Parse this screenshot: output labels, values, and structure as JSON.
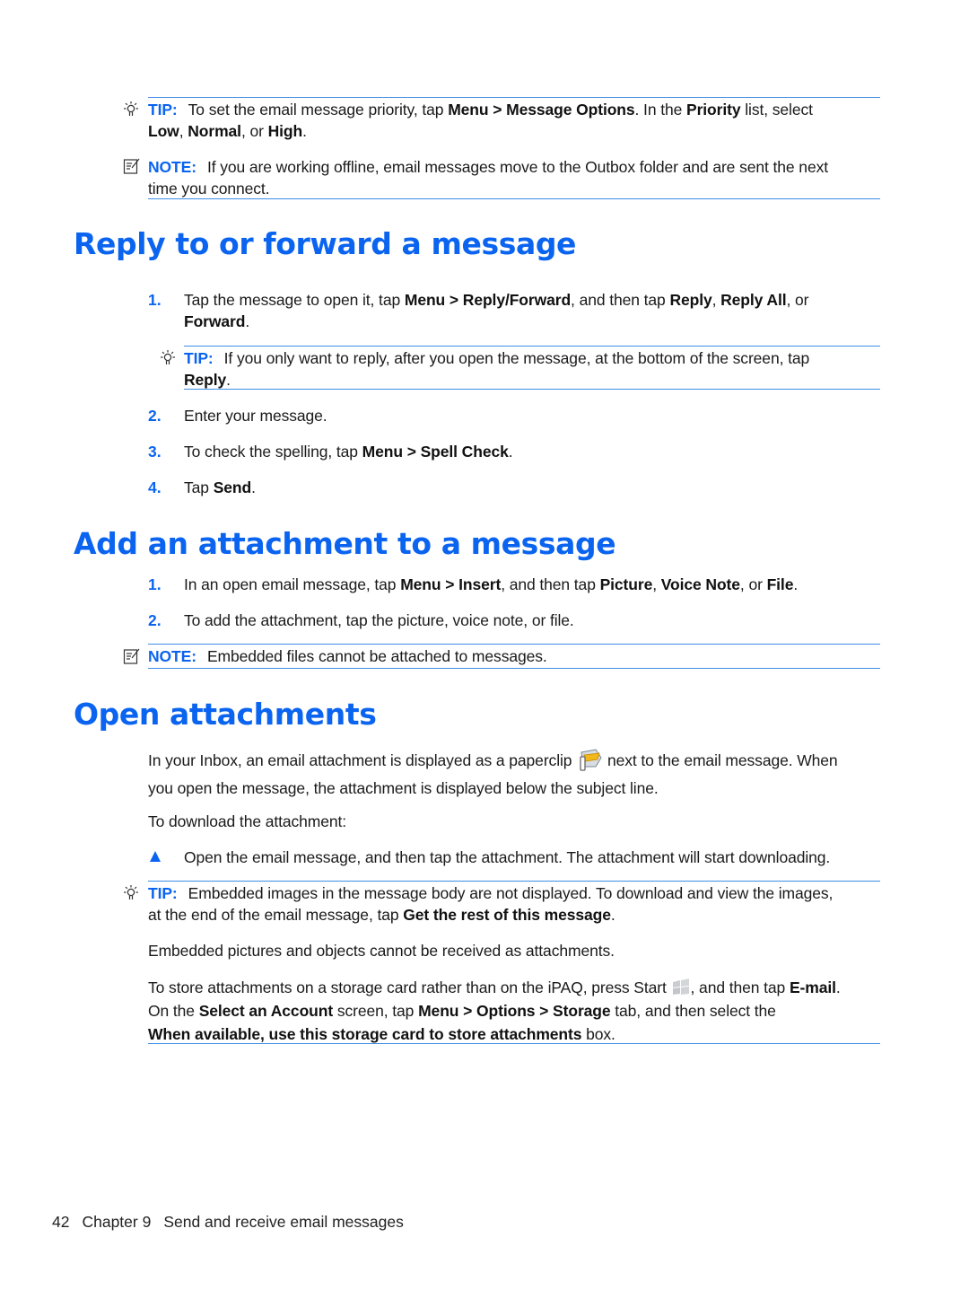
{
  "top_notes": {
    "tip1": {
      "label": "TIP:",
      "t1": "To set the email message priority, tap ",
      "b1": "Menu > Message Options",
      "t2": ". In the ",
      "b2": "Priority",
      "t3": " list, select ",
      "b3": "Low",
      "t4": ", ",
      "b4": "Normal",
      "t5": ", or ",
      "b5": "High",
      "t6": "."
    },
    "note1": {
      "label": "NOTE:",
      "line1": "If you are working offline, email messages move to the Outbox folder and are sent the next",
      "line2": "time you connect."
    }
  },
  "section_reply": {
    "title": "Reply to or forward a message",
    "steps": [
      {
        "num": "1.",
        "t1": "Tap the message to open it, tap ",
        "b1": "Menu > Reply/Forward",
        "t2": ", and then tap ",
        "b2": "Reply",
        "t3": ", ",
        "b3": "Reply All",
        "t4": ", or",
        "b4": "Forward",
        "t5": "."
      },
      {
        "num": "2.",
        "t1": "Enter your message."
      },
      {
        "num": "3.",
        "t1": "To check the spelling, tap ",
        "b1": "Menu > Spell Check",
        "t2": "."
      },
      {
        "num": "4.",
        "t1": "Tap ",
        "b1": "Send",
        "t2": "."
      }
    ],
    "tip": {
      "label": "TIP:",
      "t1": "If you only want to reply, after you open the message, at the bottom of the screen, tap",
      "b1": "Reply",
      "t2": "."
    }
  },
  "section_attach": {
    "title": "Add an attachment to a message",
    "steps": [
      {
        "num": "1.",
        "t1": "In an open email message, tap ",
        "b1": "Menu > Insert",
        "t2": ", and then tap ",
        "b2": "Picture",
        "t3": ", ",
        "b3": "Voice Note",
        "t4": ", or ",
        "b4": "File",
        "t5": "."
      },
      {
        "num": "2.",
        "t1": "To add the attachment, tap the picture, voice note, or file."
      }
    ],
    "note": {
      "label": "NOTE:",
      "text": "Embedded files cannot be attached to messages."
    }
  },
  "section_open": {
    "title": "Open attachments",
    "para1": {
      "t1": "In your Inbox, an email attachment is displayed as a paperclip",
      "t2": "next to the email message. When",
      "t3": "you open the message, the attachment is displayed below the subject line."
    },
    "para2": "To download the attachment:",
    "bullet": "Open the email message, and then tap the attachment. The attachment will start downloading.",
    "tip": {
      "label": "TIP:",
      "t1": "Embedded images in the message body are not displayed. To download and view the images,",
      "t2": "at the end of the email message, tap ",
      "b1": "Get the rest of this message",
      "t3": "."
    },
    "para3": "Embedded pictures and objects cannot be received as attachments.",
    "para4": {
      "t1": "To store attachments on a storage card rather than on the iPAQ, press Start",
      "t2": ", and then tap ",
      "b1": "E-mail",
      "t3": ".",
      "t4": "On the ",
      "b2": "Select an Account",
      "t5": " screen, tap ",
      "b3": "Menu > Options > Storage",
      "t6": " tab, and then select the",
      "b4": "When available, use this storage card to store attachments",
      "t7": " box."
    }
  },
  "footer": {
    "page": "42",
    "chapter": "Chapter 9",
    "title": "Send and receive email messages"
  },
  "icons": {
    "tip": "lightbulb-icon",
    "note": "note-pencil-icon",
    "paperclip": "paperclip-attachment-icon",
    "start": "windows-start-icon",
    "bullet": "triangle-bullet-icon"
  },
  "colors": {
    "accent": "#0a64f0",
    "rule": "#3d8ee6",
    "text": "#1a1a1a"
  }
}
